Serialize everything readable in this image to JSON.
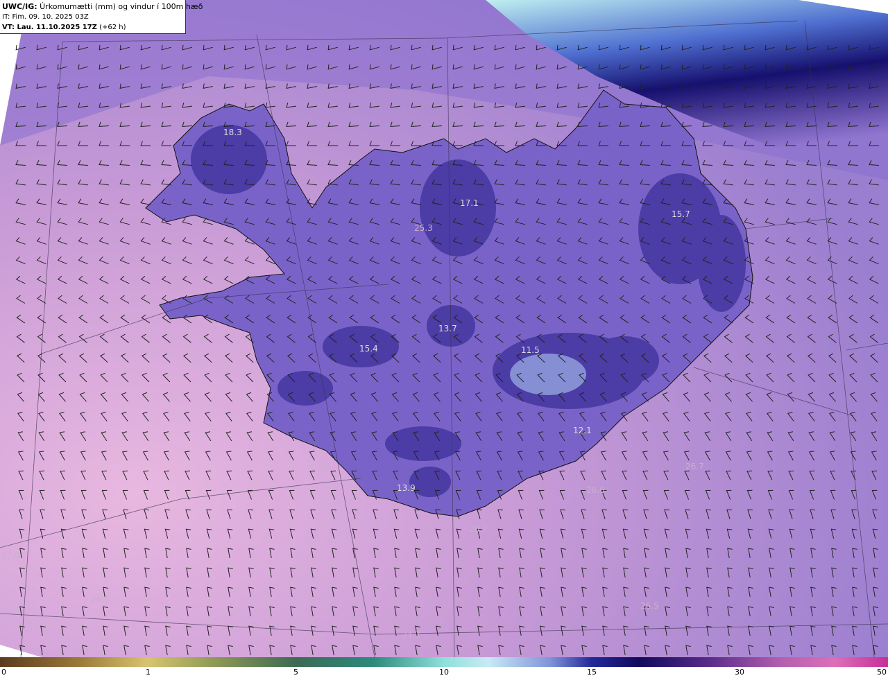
{
  "header": {
    "line1_label": "UWC/IG:",
    "line1_text": " Úrkomumætti (mm) og vindur í 100m hæð",
    "line2": "IT: Fim. 09. 10. 2025 03Z",
    "line3_label": "VT: Lau. 11.10.2025 17Z",
    "line3_text": " (+62 h)"
  },
  "colors": {
    "background_sea": "#c79ad6",
    "land_mid": "#7a63c8",
    "land_dark": "#3d2f9a",
    "jet_dark": "#16106e",
    "jet_light": "#bfeff0",
    "barb": "#222222",
    "coast": "#111111"
  },
  "map_values": [
    {
      "text": "18.3",
      "dim": false
    },
    {
      "text": "17.1",
      "dim": false
    },
    {
      "text": "15.7",
      "dim": false
    },
    {
      "text": "25.3",
      "dim": true
    },
    {
      "text": "13.7",
      "dim": false
    },
    {
      "text": "15.4",
      "dim": false
    },
    {
      "text": "11.5",
      "dim": false
    },
    {
      "text": "12.1",
      "dim": false
    },
    {
      "text": "13.9",
      "dim": false
    },
    {
      "text": "26.7",
      "dim": true
    },
    {
      "text": "26.6",
      "dim": true
    },
    {
      "text": "26.7",
      "dim": true
    },
    {
      "text": "26.5",
      "dim": true
    },
    {
      "text": "26.5",
      "dim": true
    },
    {
      "text": "24.7",
      "dim": true
    },
    {
      "text": "27.0",
      "dim": true
    },
    {
      "text": "24",
      "dim": true
    }
  ],
  "colorbar": {
    "ticks": [
      "0",
      "1",
      "5",
      "10",
      "15",
      "30",
      "50"
    ]
  }
}
